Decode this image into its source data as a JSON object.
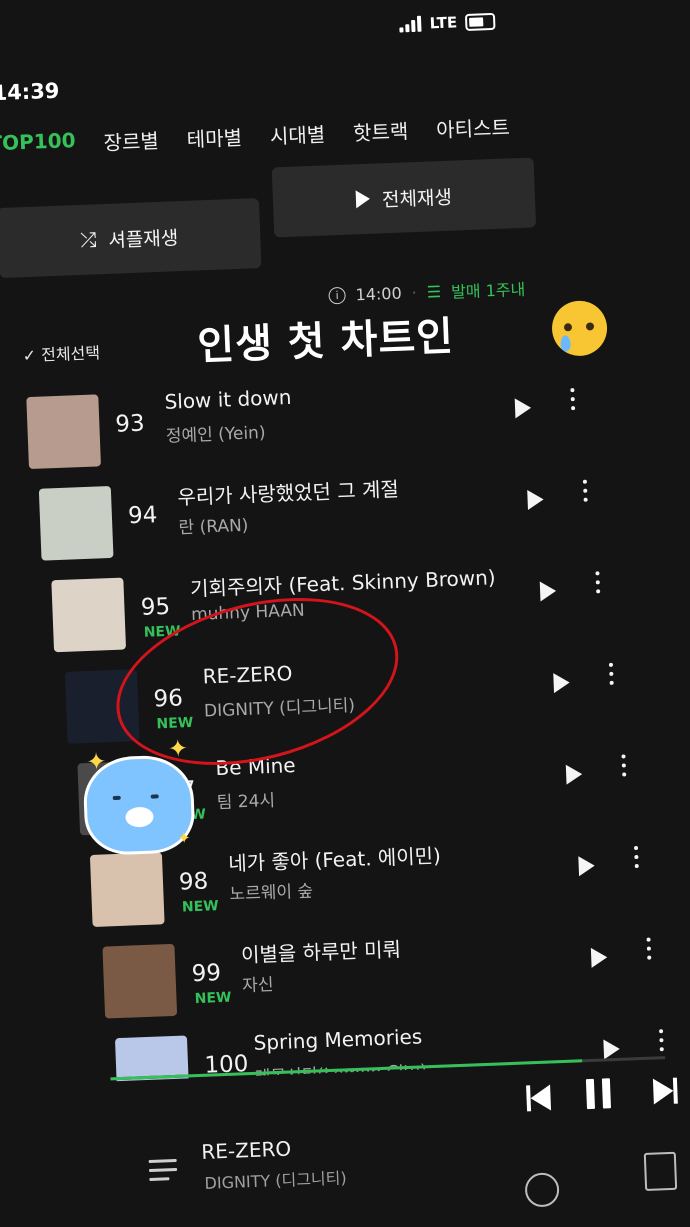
{
  "status_bar": {
    "time": "14:39",
    "network": "LTE"
  },
  "tabs": [
    "TOP100",
    "장르별",
    "테마별",
    "시대별",
    "핫트랙",
    "아티스트"
  ],
  "buttons": {
    "shuffle": "셔플재생",
    "play_all": "전체재생"
  },
  "chart_meta": {
    "time": "14:00",
    "filter": "발매 1주내"
  },
  "select_all": "전체선택",
  "overlay_caption": "인생 첫 차트인",
  "songs": [
    {
      "rank": "93",
      "title": "Slow it down",
      "artist": "정예인 (Yein)",
      "new": "",
      "thumb_color": "#b79b8e"
    },
    {
      "rank": "94",
      "title": "우리가 사랑했었던 그 계절",
      "artist": "란 (RAN)",
      "new": "",
      "thumb_color": "#c9cfc4"
    },
    {
      "rank": "95",
      "title": "기회주의자 (Feat. Skinny Brown)",
      "artist": "muhny HAAN",
      "new": "NEW",
      "thumb_color": "#ddd4c7"
    },
    {
      "rank": "96",
      "title": "RE-ZERO",
      "artist": "DIGNITY (디그니티)",
      "new": "NEW",
      "thumb_color": "#1a1f2e"
    },
    {
      "rank": "97",
      "title": "Be Mine",
      "artist": "팀 24시",
      "new": "NEW",
      "thumb_color": "#4a4a4a"
    },
    {
      "rank": "98",
      "title": "네가 좋아 (Feat. 에이민)",
      "artist": "노르웨이 숲",
      "new": "NEW",
      "thumb_color": "#d9c2ad"
    },
    {
      "rank": "99",
      "title": "이별을 하루만 미뤄",
      "artist": "자신",
      "new": "NEW",
      "thumb_color": "#7a5a44"
    },
    {
      "rank": "100",
      "title": "Spring Memories",
      "artist": "레몬시티(Lemon City)",
      "new": "NEW",
      "thumb_color": "#b9c8e8"
    }
  ],
  "now_playing": {
    "title": "RE-ZERO",
    "artist": "DIGNITY (디그니티)",
    "progress": 0.85
  },
  "colors": {
    "accent": "#35c05a",
    "background": "#141414",
    "highlight_circle": "#d4141b"
  }
}
